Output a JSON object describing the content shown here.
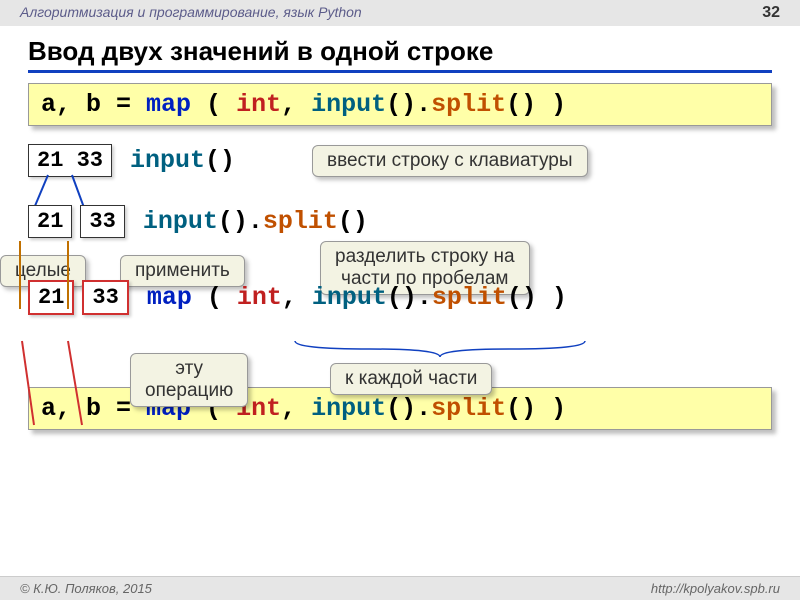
{
  "header": {
    "subject": "Алгоритмизация и программирование, язык Python",
    "page": "32"
  },
  "title": "Ввод двух значений в одной строке",
  "code_main": {
    "lhs": "a, b = ",
    "map": "map",
    "open": " ( ",
    "int": "int",
    "comma": ", ",
    "input": "input",
    "parens1": "().",
    "split": "split",
    "parens2": "() )"
  },
  "row1": {
    "box": "21 33",
    "input": "input",
    "parens": "()"
  },
  "callout_input": "ввести строку с клавиатуры",
  "row2": {
    "box1": "21",
    "box2": "33",
    "input": "input",
    "mid": "().",
    "split": "split",
    "end": "()"
  },
  "callout_ints": "целые",
  "callout_apply": "применить",
  "callout_split": "разделить строку на\nчасти по пробелам",
  "row3": {
    "box1": "21",
    "box2": "33",
    "map": "map",
    "open": " ( ",
    "int": "int",
    "comma": ", ",
    "input": "input",
    "mid": "().",
    "split": "split",
    "end": "() )"
  },
  "callout_op": "эту\nоперацию",
  "callout_each": "к каждой части",
  "footer": {
    "author": "© К.Ю. Поляков, 2015",
    "url": "http://kpolyakov.spb.ru"
  }
}
